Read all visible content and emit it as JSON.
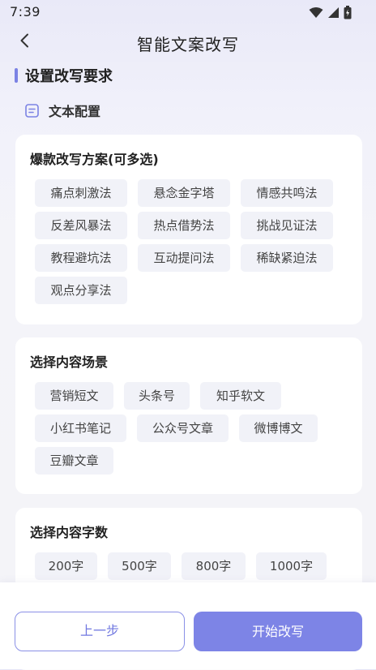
{
  "status_bar": {
    "time": "7:39",
    "icons": [
      "wifi-icon",
      "cellular-signal-icon",
      "battery-icon"
    ]
  },
  "nav": {
    "title": "智能文案改写",
    "back_icon": "chevron-left-icon"
  },
  "section": {
    "heading": "设置改写要求",
    "sub_heading": "文本配置",
    "sub_icon": "document-icon"
  },
  "cards": {
    "schemes": {
      "title": "爆款改写方案(可多选)",
      "options": [
        "痛点刺激法",
        "悬念金字塔",
        "情感共鸣法",
        "反差风暴法",
        "热点借势法",
        "挑战见证法",
        "教程避坑法",
        "互动提问法",
        "稀缺紧迫法",
        "观点分享法"
      ]
    },
    "scenes": {
      "title": "选择内容场景",
      "options": [
        "营销短文",
        "头条号",
        "知乎软文",
        "小红书笔记",
        "公众号文章",
        "微博博文",
        "豆瓣文章"
      ]
    },
    "word_count": {
      "title": "选择内容字数",
      "options": [
        "200字",
        "500字",
        "800字",
        "1000字"
      ]
    }
  },
  "footer": {
    "prev_label": "上一步",
    "start_label": "开始改写"
  },
  "colors": {
    "accent": "#7d84e6",
    "chip_bg": "#f1f2f8",
    "page_bg": "#f4f4f9"
  }
}
